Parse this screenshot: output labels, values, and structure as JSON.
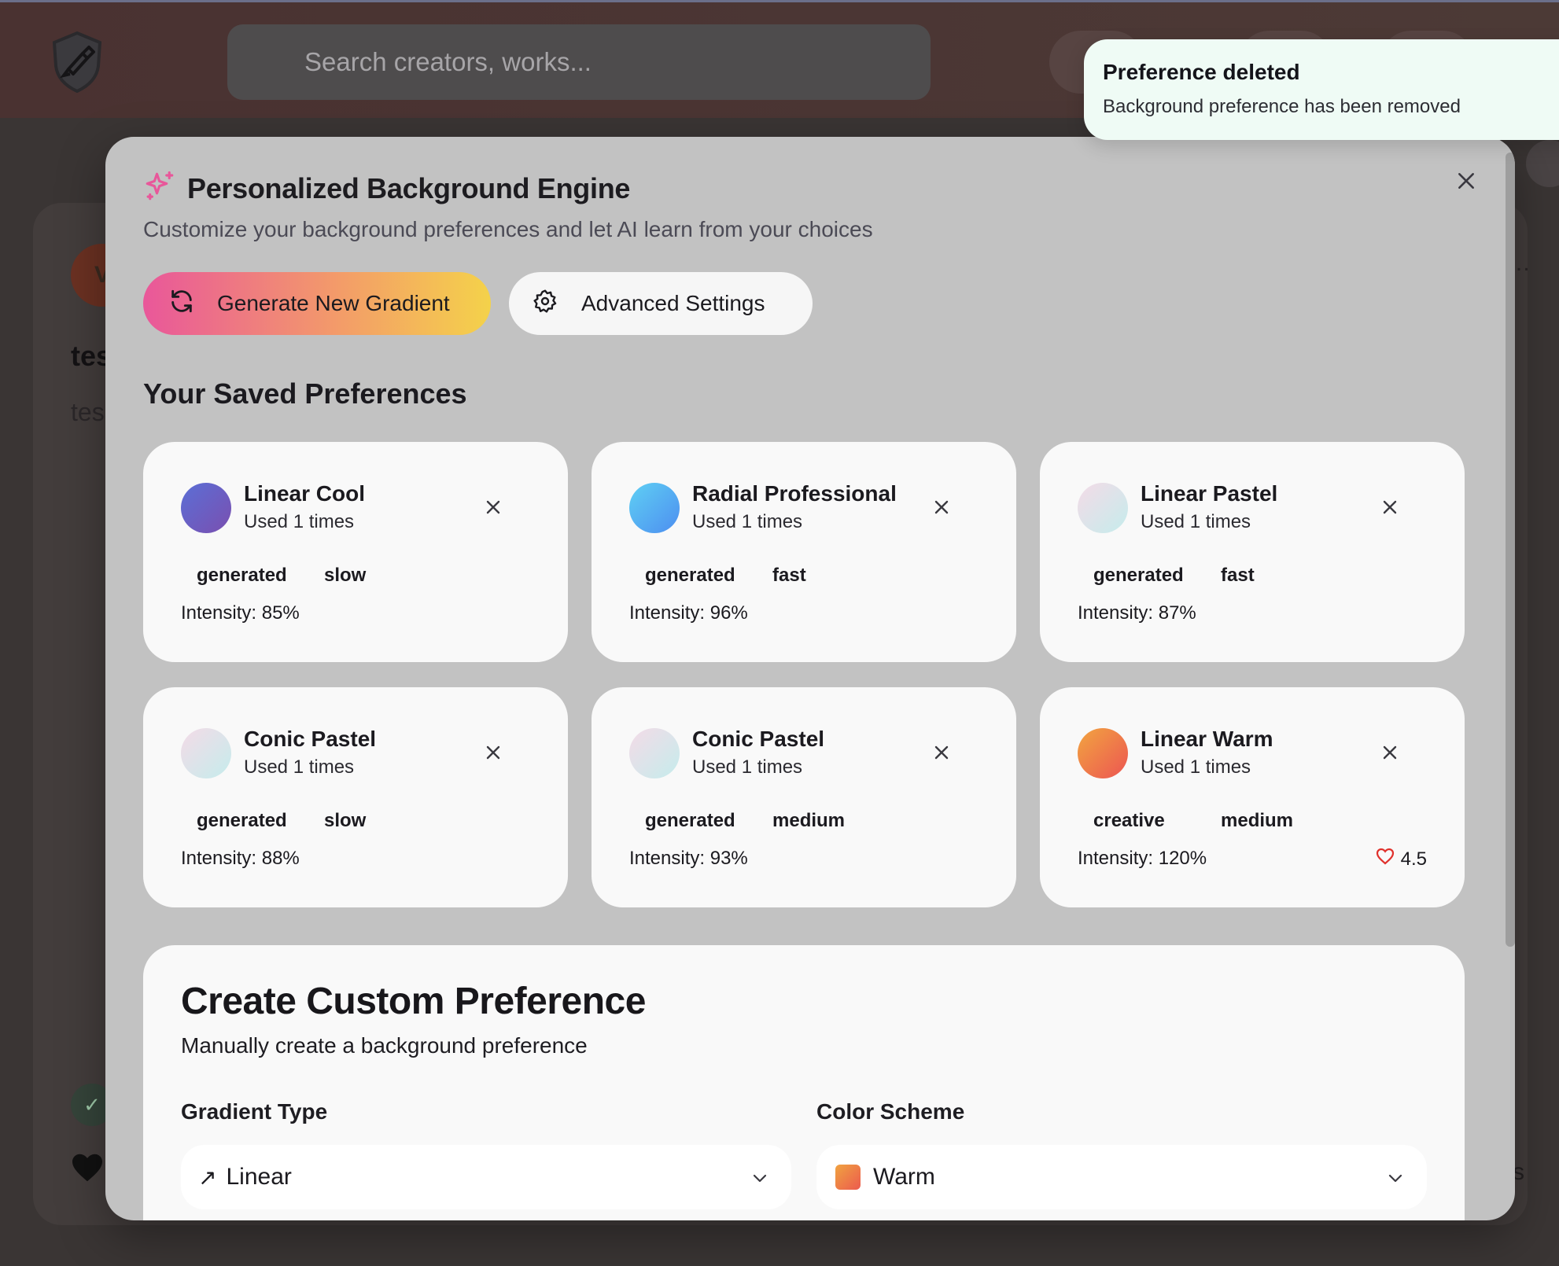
{
  "app": {
    "search_placeholder": "Search creators, works...",
    "bg_avatar_letter": "V",
    "bg_title": "tes",
    "bg_text": "tes",
    "bg_check": "✓",
    "bg_right_text": "vs"
  },
  "modal": {
    "title": "Personalized Background Engine",
    "subtitle": "Customize your background preferences and let AI learn from your choices",
    "generate_label": "Generate New Gradient",
    "advanced_label": "Advanced Settings",
    "section_title": "Your Saved Preferences",
    "preferences": [
      {
        "name": "Linear Cool",
        "used": "Used 1 times",
        "tag1": "generated",
        "tag2": "slow",
        "intensity": "Intensity: 85%",
        "swatch": [
          "#5b6fd6",
          "#7a4fb0"
        ]
      },
      {
        "name": "Radial Professional",
        "used": "Used 1 times",
        "tag1": "generated",
        "tag2": "fast",
        "intensity": "Intensity: 96%",
        "swatch": [
          "#5fd0f4",
          "#4d8ef0"
        ]
      },
      {
        "name": "Linear Pastel",
        "used": "Used 1 times",
        "tag1": "generated",
        "tag2": "fast",
        "intensity": "Intensity: 87%",
        "swatch": [
          "#f4dbe7",
          "#c5ecec"
        ]
      },
      {
        "name": "Conic Pastel",
        "used": "Used 1 times",
        "tag1": "generated",
        "tag2": "slow",
        "intensity": "Intensity: 88%",
        "swatch": [
          "#f4dbe7",
          "#c5ecec"
        ]
      },
      {
        "name": "Conic Pastel",
        "used": "Used 1 times",
        "tag1": "generated",
        "tag2": "medium",
        "intensity": "Intensity: 93%",
        "swatch": [
          "#f4dbe7",
          "#c5ecec"
        ]
      },
      {
        "name": "Linear Warm",
        "used": "Used 1 times",
        "tag1": "creative",
        "tag2": "medium",
        "intensity": "Intensity: 120%",
        "rating": "4.5",
        "swatch": [
          "#f2a540",
          "#ec5552"
        ]
      }
    ],
    "custom": {
      "title": "Create Custom Preference",
      "subtitle": "Manually create a background preference",
      "gradient_label": "Gradient Type",
      "gradient_value": "Linear",
      "gradient_icon": "↗",
      "scheme_label": "Color Scheme",
      "scheme_value": "Warm"
    }
  },
  "toast": {
    "title": "Preference deleted",
    "description": "Background preference has been removed"
  },
  "colors": {
    "accent_pink": "#e9579a",
    "accent_yellow": "#f4d24a",
    "heart_red": "#e0312c",
    "toast_bg": "#effbf5"
  }
}
